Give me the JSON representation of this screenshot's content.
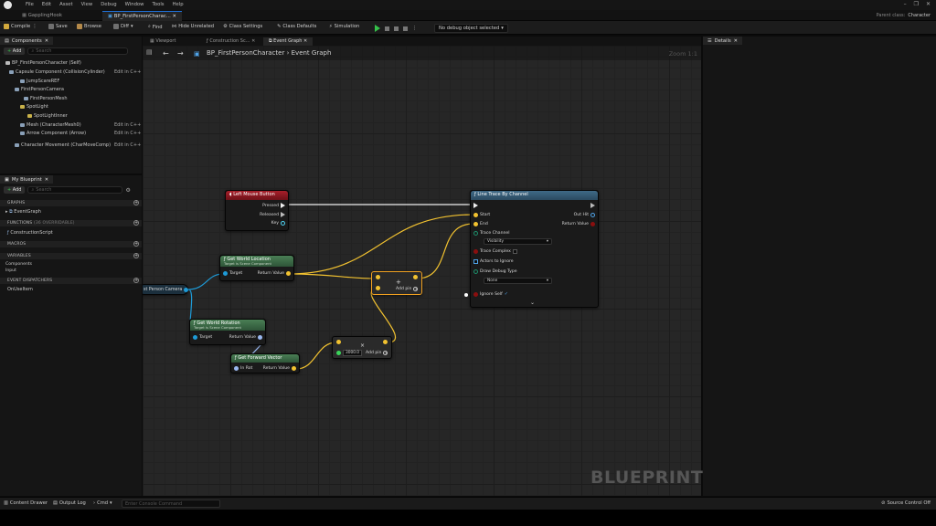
{
  "menu": [
    "File",
    "Edit",
    "Asset",
    "View",
    "Debug",
    "Window",
    "Tools",
    "Help"
  ],
  "doc_tabs": [
    "GapplingHook",
    "BP_FirstPersonCharac..."
  ],
  "parent_class": {
    "label": "Parent class:",
    "value": "Character"
  },
  "toolbar": {
    "compile": "Compile",
    "save": "Save",
    "browse": "Browse",
    "diff": "Diff",
    "find": "Find",
    "hide_unrelated": "Hide Unrelated",
    "class_settings": "Class Settings",
    "class_defaults": "Class Defaults",
    "simulation": "Simulation",
    "debug_object": "No debug object selected"
  },
  "components": {
    "tab": "Components",
    "add": "Add",
    "search_placeholder": "Search",
    "items": [
      {
        "label": "BP_FirstPersonCharacter (Self)",
        "edit": ""
      },
      {
        "label": "Capsule Component (CollisionCylinder)",
        "edit": "Edit in C++"
      },
      {
        "label": "JumpScareREF",
        "edit": ""
      },
      {
        "label": "FirstPersonCamera",
        "edit": ""
      },
      {
        "label": "FirstPersonMesh",
        "edit": ""
      },
      {
        "label": "SpotLight",
        "edit": ""
      },
      {
        "label": "SpotLightInner",
        "edit": ""
      },
      {
        "label": "Mesh (CharacterMesh0)",
        "edit": "Edit in C++"
      },
      {
        "label": "Arrow Component (Arrow)",
        "edit": "Edit in C++"
      },
      {
        "label": "Character Movement (CharMoveComp)",
        "edit": "Edit in C++"
      }
    ]
  },
  "my_blueprint": {
    "tab": "My Blueprint",
    "add": "Add",
    "search_placeholder": "Search",
    "graphs_head": "GRAPHS",
    "graphs": [
      "EventGraph"
    ],
    "functions_head": "FUNCTIONS",
    "functions_note": "(36 OVERRIDABLE)",
    "functions": [
      "ConstructionScript"
    ],
    "macros_head": "MACROS",
    "variables_head": "VARIABLES",
    "variables": [
      "Components",
      "Input"
    ],
    "dispatchers_head": "EVENT DISPATCHERS",
    "dispatchers": [
      "OnUseItem"
    ]
  },
  "graph_tabs": [
    "Viewport",
    "Construction Sc...",
    "Event Graph"
  ],
  "breadcrumb": {
    "blueprint": "BP_FirstPersonCharacter",
    "graph": "Event Graph",
    "sep": "›"
  },
  "zoom": "Zoom 1:1",
  "watermark": "BLUEPRINT",
  "nodes": {
    "lmb": {
      "title": "Left Mouse Button",
      "pins": [
        "Pressed",
        "Released",
        "Key"
      ]
    },
    "line_trace": {
      "title": "Line Trace By Channel",
      "inputs": [
        "Start",
        "End"
      ],
      "outputs": [
        "Out Hit",
        "Return Value"
      ],
      "trace_channel_label": "Trace Channel",
      "trace_channel": "Visibility",
      "trace_complex": "Trace Complex",
      "actors_to_ignore": "Actors to Ignore",
      "draw_debug_label": "Draw Debug Type",
      "draw_debug": "None",
      "ignore_self": "Ignore Self"
    },
    "get_world_location": {
      "title": "Get World Location",
      "subtitle": "Target is Scene Component",
      "in": "Target",
      "out": "Return Value"
    },
    "get_world_rotation": {
      "title": "Get World Rotation",
      "subtitle": "Target is Scene Component",
      "in": "Target",
      "out": "Return Value"
    },
    "get_forward_vector": {
      "title": "Get Forward Vector",
      "in": "In Rot",
      "out": "Return Value"
    },
    "camera_ref": {
      "title": "st Person Camera"
    },
    "add_node": {
      "symbol": "+",
      "add_pin": "Add pin"
    },
    "multiply_node": {
      "symbol": "×",
      "value": "3000.0",
      "add_pin": "Add pin"
    }
  },
  "details": {
    "tab": "Details"
  },
  "bottom": {
    "content_drawer": "Content Drawer",
    "output_log": "Output Log",
    "cmd": "Cmd",
    "cmd_placeholder": "Enter Console Command",
    "source_control": "Source Control Off"
  },
  "colors": {
    "exec": "#eeeeee",
    "vector": "#f2c230",
    "object": "#1e9ad6",
    "rotator": "#9ab8f0",
    "bool": "#8a0f0f",
    "float": "#3ad45a",
    "event_header": "#9b1c26",
    "pure_header": "#3c6b45",
    "func_header": "#3f6a87"
  }
}
